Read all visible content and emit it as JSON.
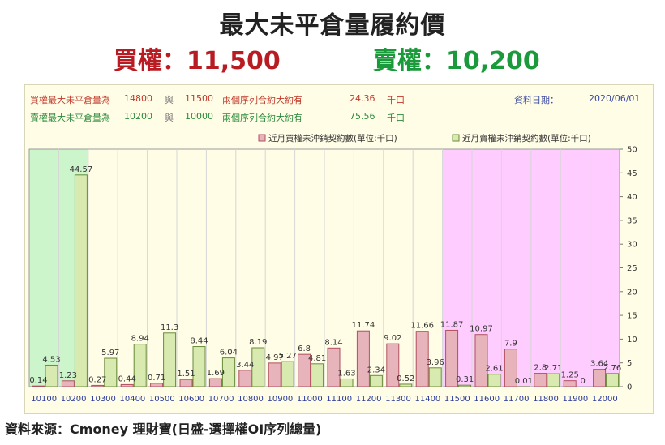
{
  "header": {
    "title": "最大未平倉量履約價",
    "call_label": "買權：11,500",
    "put_label": "賣權：10,200"
  },
  "info": {
    "call_row": {
      "label": "買權最大未平倉量為",
      "strike1": "14800",
      "and": "與",
      "strike2": "11500",
      "mid": "兩個序列合約大約有",
      "amount": "24.36",
      "unit": "千口"
    },
    "put_row": {
      "label": "賣權最大未平倉量為",
      "strike1": "10200",
      "and": "與",
      "strike2": "10000",
      "mid": "兩個序列合約大約有",
      "amount": "75.56",
      "unit": "千口"
    },
    "date_label": "資料日期：",
    "date_value": "2020/06/01"
  },
  "colors": {
    "call_bar": "#e8b4bc",
    "call_border": "#b0505e",
    "put_bar": "#d8eab0",
    "put_border": "#6a8a3a",
    "put_highlight": "#ccf5cc",
    "call_highlight": "#ffccff"
  },
  "chart_data": {
    "type": "bar",
    "categories": [
      "10100",
      "10200",
      "10300",
      "10400",
      "10500",
      "10600",
      "10700",
      "10800",
      "10900",
      "11000",
      "11100",
      "11200",
      "11300",
      "11400",
      "11500",
      "11600",
      "11700",
      "11800",
      "11900",
      "12000"
    ],
    "series": [
      {
        "name": "近月買權未沖銷契約數(單位:千口)",
        "values": [
          0.14,
          1.23,
          0.27,
          0.44,
          0.71,
          1.51,
          1.69,
          3.44,
          4.97,
          6.8,
          8.14,
          11.74,
          9.02,
          11.66,
          11.87,
          10.97,
          7.9,
          2.8,
          1.25,
          3.64
        ]
      },
      {
        "name": "近月賣權未沖銷契約數(單位:千口)",
        "values": [
          4.53,
          44.57,
          5.97,
          8.94,
          11.3,
          8.44,
          6.04,
          8.19,
          5.27,
          4.81,
          1.63,
          2.34,
          0.52,
          3.96,
          0.31,
          2.61,
          0.01,
          2.71,
          0,
          2.76
        ]
      }
    ],
    "ylim": [
      0,
      50
    ],
    "yticks": [
      0,
      5,
      10,
      15,
      20,
      25,
      30,
      35,
      40,
      45,
      50
    ],
    "y_axis_side": "right",
    "legend": "top-right",
    "highlight_put_range": [
      "10100",
      "10200"
    ],
    "highlight_call_range": [
      "11500",
      "12000"
    ]
  },
  "source": "資料來源：Cmoney 理財寶(日盛-選擇權OI序列總量)"
}
